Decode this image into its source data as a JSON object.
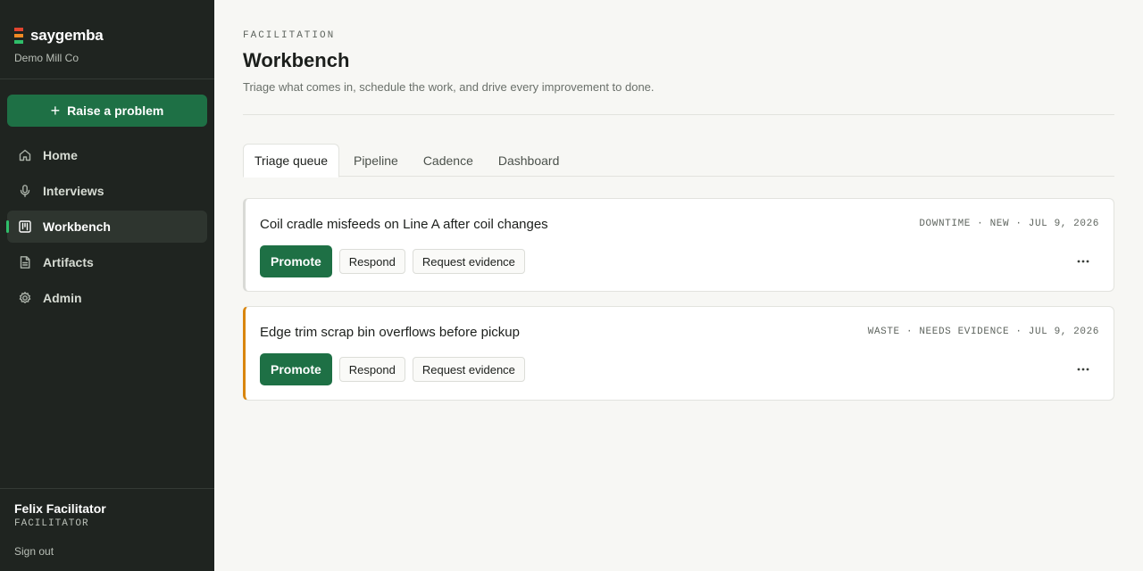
{
  "brand": {
    "name": "saygemba",
    "org": "Demo Mill Co",
    "logo_colors": [
      "#e2452f",
      "#f08a24",
      "#2fbf6a"
    ]
  },
  "sidebar": {
    "raise_label": "Raise a problem",
    "items": [
      {
        "label": "Home",
        "icon": "home-icon"
      },
      {
        "label": "Interviews",
        "icon": "microphone-icon"
      },
      {
        "label": "Workbench",
        "icon": "board-icon",
        "active": true
      },
      {
        "label": "Artifacts",
        "icon": "document-icon"
      },
      {
        "label": "Admin",
        "icon": "gear-icon"
      }
    ],
    "user": {
      "name": "Felix Facilitator",
      "role": "FACILITATOR"
    },
    "sign_out": "Sign out"
  },
  "header": {
    "eyebrow": "FACILITATION",
    "title": "Workbench",
    "subtitle": "Triage what comes in, schedule the work, and drive every improvement to done."
  },
  "tabs": [
    {
      "label": "Triage queue",
      "active": true
    },
    {
      "label": "Pipeline"
    },
    {
      "label": "Cadence"
    },
    {
      "label": "Dashboard"
    }
  ],
  "cards": [
    {
      "title": "Coil cradle misfeeds on Line A after coil changes",
      "meta": "DOWNTIME · NEW · JUL 9, 2026",
      "accent": "#d9dad6",
      "promote": "Promote",
      "respond": "Respond",
      "request": "Request evidence"
    },
    {
      "title": "Edge trim scrap bin overflows before pickup",
      "meta": "WASTE · NEEDS EVIDENCE · JUL 9, 2026",
      "accent": "#d9860f",
      "promote": "Promote",
      "respond": "Respond",
      "request": "Request evidence"
    }
  ]
}
